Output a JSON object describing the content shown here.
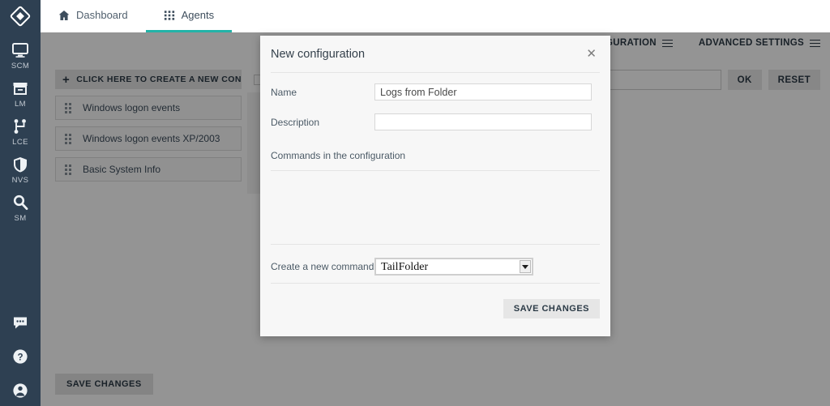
{
  "sidebar": {
    "logo_icon": "diamond-logo-icon",
    "items": [
      {
        "icon": "monitor-icon",
        "label": "SCM"
      },
      {
        "icon": "archive-box-icon",
        "label": "LM"
      },
      {
        "icon": "branch-network-icon",
        "label": "LCE"
      },
      {
        "icon": "shield-icon",
        "label": "NVS"
      },
      {
        "icon": "magnifier-icon",
        "label": "SM"
      }
    ],
    "bottom_items": [
      {
        "icon": "chat-bubble-icon",
        "label": ""
      },
      {
        "icon": "help-circle-icon",
        "label": ""
      },
      {
        "icon": "user-circle-icon",
        "label": ""
      }
    ]
  },
  "topbar": {
    "tabs": [
      {
        "label": "Dashboard",
        "icon": "home-icon",
        "active": false
      },
      {
        "label": "Agents",
        "icon": "grid-icon",
        "active": true
      }
    ]
  },
  "page": {
    "toolbar": {
      "agents_configuration": "AGENTS CONFIGURATION",
      "advanced_settings": "ADVANCED SETTINGS"
    },
    "search": {
      "value": "",
      "placeholder": "",
      "ok_label": "OK",
      "reset_label": "RESET"
    },
    "create_button_label": "CLICK HERE TO CREATE A NEW CONFIGURATION",
    "configurations": [
      {
        "name": "Windows logon events"
      },
      {
        "name": "Windows logon events XP/2003"
      },
      {
        "name": "Basic System Info"
      }
    ],
    "save_changes_label": "SAVE CHANGES"
  },
  "modal": {
    "title": "New configuration",
    "close_label": "✕",
    "name_label": "Name",
    "name_value": "Logs from Folder",
    "name_placeholder": "",
    "description_label": "Description",
    "description_value": "",
    "description_placeholder": "",
    "commands_section_label": "Commands in the configuration",
    "create_command_label": "Create a new command",
    "create_command_value": "TailFolder",
    "create_command_options": [
      "TailFolder"
    ],
    "save_changes_label": "SAVE CHANGES"
  },
  "colors": {
    "sidebar_bg": "#2e4052",
    "accent_teal": "#23b3a8",
    "modal_bg": "#f7f7f7",
    "overlay": "rgba(0,0,0,0.42)",
    "button_grey": "#e4e4e4"
  }
}
